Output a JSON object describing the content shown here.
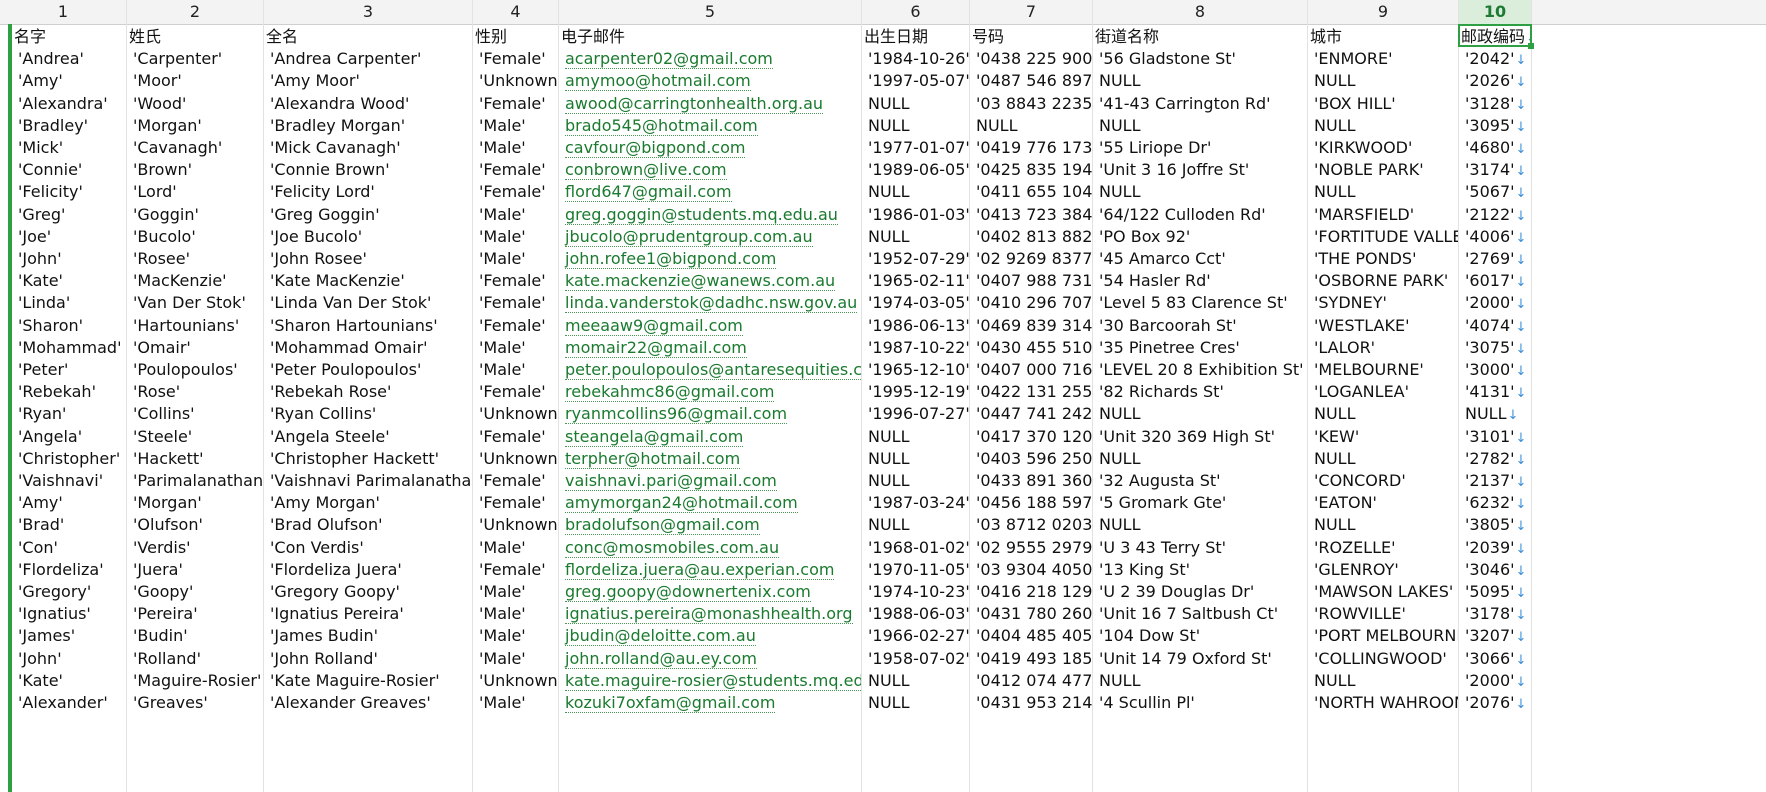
{
  "colors": {
    "accent": "#2ea043",
    "email_text": "#1a7a2e",
    "arrow": "#3a8fd9"
  },
  "column_numbers": [
    "1",
    "2",
    "3",
    "4",
    "5",
    "6",
    "7",
    "8",
    "9",
    "10"
  ],
  "headers": [
    "名字",
    "姓氏",
    "全名",
    "性别",
    "电子邮件",
    "出生日期",
    "号码",
    "街道名称",
    "城市",
    "邮政编码"
  ],
  "rows": [
    [
      "'Andrea'",
      "'Carpenter'",
      "'Andrea Carpenter'",
      "'Female'",
      "acarpenter02@gmail.com",
      "'1984-10-26'",
      "'0438 225 900'",
      "'56 Gladstone St'",
      "'ENMORE'",
      "'2042'"
    ],
    [
      "'Amy'",
      "'Moor'",
      "'Amy Moor'",
      "'Unknown'",
      "amymoo@hotmail.com",
      "'1997-05-07'",
      "'0487 546 897'",
      "NULL",
      "NULL",
      "'2026'"
    ],
    [
      "'Alexandra'",
      "'Wood'",
      "'Alexandra Wood'",
      "'Female'",
      "awood@carringtonhealth.org.au",
      "NULL",
      "'03 8843 2235'",
      "'41-43 Carrington Rd'",
      "'BOX HILL'",
      "'3128'"
    ],
    [
      "'Bradley'",
      "'Morgan'",
      "'Bradley Morgan'",
      "'Male'",
      "brado545@hotmail.com",
      "NULL",
      "NULL",
      "NULL",
      "NULL",
      "'3095'"
    ],
    [
      "'Mick'",
      "'Cavanagh'",
      "'Mick Cavanagh'",
      "'Male'",
      "cavfour@bigpond.com",
      "'1977-01-07'",
      "'0419 776 173'",
      "'55 Liriope Dr'",
      "'KIRKWOOD'",
      "'4680'"
    ],
    [
      "'Connie'",
      "'Brown'",
      "'Connie Brown'",
      "'Female'",
      "conbrown@live.com",
      "'1989-06-05'",
      "'0425 835 194'",
      "'Unit 3  16 Joffre St'",
      "'NOBLE PARK'",
      "'3174'"
    ],
    [
      "'Felicity'",
      "'Lord'",
      "'Felicity Lord'",
      "'Female'",
      "flord647@gmail.com",
      "NULL",
      "'0411 655 104'",
      "NULL",
      "NULL",
      "'5067'"
    ],
    [
      "'Greg'",
      "'Goggin'",
      "'Greg Goggin'",
      "'Male'",
      "greg.goggin@students.mq.edu.au",
      "'1986-01-03'",
      "'0413 723 384'",
      "'64/122 Culloden Rd'",
      "'MARSFIELD'",
      "'2122'"
    ],
    [
      "'Joe'",
      "'Bucolo'",
      "'Joe Bucolo'",
      "'Male'",
      "jbucolo@prudentgroup.com.au",
      "NULL",
      "'0402 813 882'",
      "'PO Box 92'",
      "'FORTITUDE VALLEY'",
      "'4006'"
    ],
    [
      "'John'",
      "'Rosee'",
      "'John Rosee'",
      "'Male'",
      "john.rofee1@bigpond.com",
      "'1952-07-29'",
      "'02 9269 8377'",
      "'45 Amarco Cct'",
      "'THE PONDS'",
      "'2769'"
    ],
    [
      "'Kate'",
      "'MacKenzie'",
      "'Kate MacKenzie'",
      "'Female'",
      "kate.mackenzie@wanews.com.au",
      "'1965-02-11'",
      "'0407 988 731'",
      "'54 Hasler Rd'",
      "'OSBORNE PARK'",
      "'6017'"
    ],
    [
      "'Linda'",
      "'Van Der Stok'",
      "'Linda Van Der Stok'",
      "'Female'",
      "linda.vanderstok@dadhc.nsw.gov.au",
      "'1974-03-05'",
      "'0410 296 707'",
      "'Level 5  83 Clarence St'",
      "'SYDNEY'",
      "'2000'"
    ],
    [
      "'Sharon'",
      "'Hartounians'",
      "'Sharon Hartounians'",
      "'Female'",
      "meeaaw9@gmail.com",
      "'1986-06-13'",
      "'0469 839 314'",
      "'30 Barcoorah St'",
      "'WESTLAKE'",
      "'4074'"
    ],
    [
      "'Mohammad'",
      "'Omair'",
      "'Mohammad Omair'",
      "'Male'",
      "momair22@gmail.com",
      "'1987-10-22'",
      "'0430 455 510'",
      "'35 Pinetree Cres'",
      "'LALOR'",
      "'3075'"
    ],
    [
      "'Peter'",
      "'Poulopoulos'",
      "'Peter Poulopoulos'",
      "'Male'",
      "peter.poulopoulos@antaresequities.com.au",
      "'1965-12-10'",
      "'0407 000 716'",
      "'LEVEL 20  8 Exhibition St'",
      "'MELBOURNE'",
      "'3000'"
    ],
    [
      "'Rebekah'",
      "'Rose'",
      "'Rebekah Rose'",
      "'Female'",
      "rebekahmc86@gmail.com",
      "'1995-12-19'",
      "'0422 131 255'",
      "'82 Richards St'",
      "'LOGANLEA'",
      "'4131'"
    ],
    [
      "'Ryan'",
      "'Collins'",
      "'Ryan Collins'",
      "'Unknown'",
      "ryanmcollins96@gmail.com",
      "'1996-07-27'",
      "'0447 741 242'",
      "NULL",
      "NULL",
      "NULL"
    ],
    [
      "'Angela'",
      "'Steele'",
      "'Angela Steele'",
      "'Female'",
      "steangela@gmail.com",
      "NULL",
      "'0417 370 120'",
      "'Unit 320 369 High St'",
      "'KEW'",
      "'3101'"
    ],
    [
      "'Christopher'",
      "'Hackett'",
      "'Christopher Hackett'",
      "'Unknown'",
      "terpher@hotmail.com",
      "NULL",
      "'0403 596 250'",
      "NULL",
      "NULL",
      "'2782'"
    ],
    [
      "'Vaishnavi'",
      "'Parimalanathan'",
      "'Vaishnavi Parimalanathan'",
      "'Female'",
      "vaishnavi.pari@gmail.com",
      "NULL",
      "'0433 891 360'",
      "'32 Augusta St'",
      "'CONCORD'",
      "'2137'"
    ],
    [
      "'Amy'",
      "'Morgan'",
      "'Amy Morgan'",
      "'Female'",
      "amymorgan24@hotmail.com",
      "'1987-03-24'",
      "'0456 188 597'",
      "'5 Gromark Gte'",
      "'EATON'",
      "'6232'"
    ],
    [
      "'Brad'",
      "'Olufson'",
      "'Brad Olufson'",
      "'Unknown'",
      "bradolufson@gmail.com",
      "NULL",
      "'03 8712 0203'",
      "NULL",
      "NULL",
      "'3805'"
    ],
    [
      "'Con'",
      "'Verdis'",
      "'Con Verdis'",
      "'Male'",
      "conc@mosmobiles.com.au",
      "'1968-01-02'",
      "'02 9555 2979'",
      "'U 3  43 Terry St'",
      "'ROZELLE'",
      "'2039'"
    ],
    [
      "'Flordeliza'",
      "'Juera'",
      "'Flordeliza Juera'",
      "'Female'",
      "flordeliza.juera@au.experian.com",
      "'1970-11-05'",
      "'03 9304 4050'",
      "'13 King St'",
      "'GLENROY'",
      "'3046'"
    ],
    [
      "'Gregory'",
      "'Goopy'",
      "'Gregory Goopy'",
      "'Male'",
      "greg.goopy@downertenix.com",
      "'1974-10-23'",
      "'0416 218 129'",
      "'U 2  39 Douglas Dr'",
      "'MAWSON LAKES'",
      "'5095'"
    ],
    [
      "'Ignatius'",
      "'Pereira'",
      "'Ignatius Pereira'",
      "'Male'",
      "ignatius.pereira@monashhealth.org",
      "'1988-06-03'",
      "'0431 780 260'",
      "'Unit 16 7 Saltbush Ct'",
      "'ROWVILLE'",
      "'3178'"
    ],
    [
      "'James'",
      "'Budin'",
      "'James Budin'",
      "'Male'",
      "jbudin@deloitte.com.au",
      "'1966-02-27'",
      "'0404 485 405'",
      "'104 Dow St'",
      "'PORT MELBOURNE'",
      "'3207'"
    ],
    [
      "'John'",
      "'Rolland'",
      "'John Rolland'",
      "'Male'",
      "john.rolland@au.ey.com",
      "'1958-07-02'",
      "'0419 493 185'",
      "'Unit 14  79 Oxford St'",
      "'COLLINGWOOD'",
      "'3066'"
    ],
    [
      "'Kate'",
      "'Maguire-Rosier'",
      "'Kate Maguire-Rosier'",
      "'Unknown'",
      "kate.maguire-rosier@students.mq.edu.au",
      "NULL",
      "'0412 074 477'",
      "NULL",
      "NULL",
      "'2000'"
    ],
    [
      "'Alexander'",
      "'Greaves'",
      "'Alexander Greaves'",
      "'Male'",
      "kozuki7oxfam@gmail.com",
      "NULL",
      "'0431 953 214'",
      "'4 Scullin Pl'",
      "'NORTH WAHROONGA'",
      "'2076'"
    ]
  ]
}
